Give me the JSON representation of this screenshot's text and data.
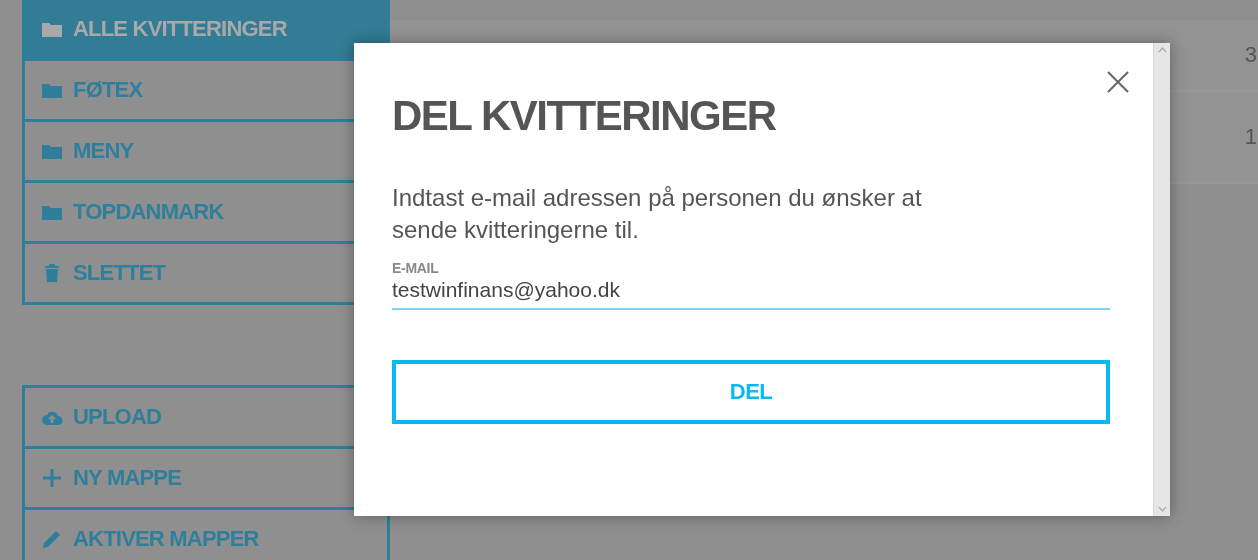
{
  "sidebar": {
    "folders": [
      {
        "label": "ALLE KVITTERINGER",
        "kind": "folder",
        "selected": true
      },
      {
        "label": "FØTEX",
        "kind": "folder",
        "selected": false
      },
      {
        "label": "MENY",
        "kind": "folder",
        "selected": false
      },
      {
        "label": "TOPDANMARK",
        "kind": "folder",
        "selected": false
      },
      {
        "label": "SLETTET",
        "kind": "trash",
        "selected": false
      }
    ],
    "actions": [
      {
        "label": "UPLOAD",
        "kind": "upload"
      },
      {
        "label": "NY MAPPE",
        "kind": "plus"
      },
      {
        "label": "AKTIVER MAPPER",
        "kind": "pencil"
      }
    ]
  },
  "table": {
    "rows": [
      {
        "column_4": "3"
      },
      {
        "column_4": "1"
      }
    ]
  },
  "dialog": {
    "title": "DEL KVITTERINGER",
    "message": "Indtast e-mail adressen på personen du ønsker at sende kvitteringerne til.",
    "email_label": "E-MAIL",
    "email_value": "testwinfinans@yahoo.dk",
    "button": "DEL"
  }
}
